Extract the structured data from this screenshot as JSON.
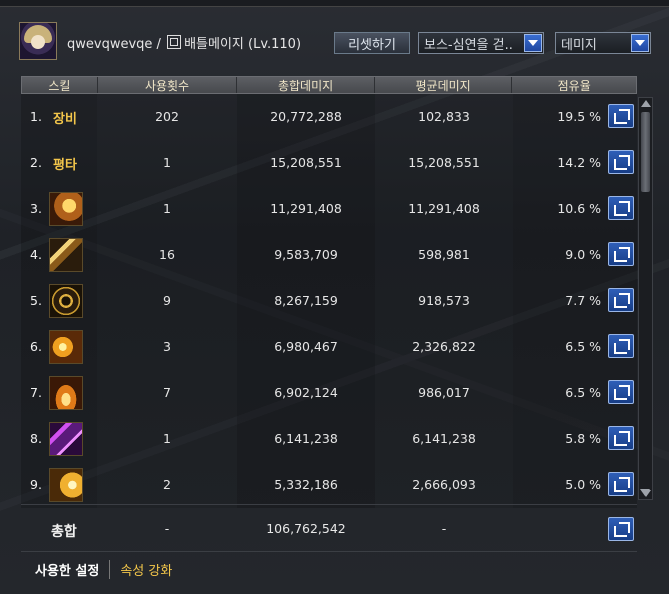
{
  "header": {
    "player_name": "qwevqwevqe",
    "separator": "/",
    "meter_title": "배틀메이지 (Lv.110)",
    "reset_button": "리셋하기",
    "dropdown_target": "보스-심연을 걷..",
    "dropdown_metric": "데미지"
  },
  "table": {
    "columns": [
      "스킬",
      "사용횟수",
      "총합데미지",
      "평균데미지",
      "점유율"
    ],
    "rows": [
      {
        "rank": "1.",
        "skill_text": "장비",
        "icon": null,
        "uses": "202",
        "total": "20,772,288",
        "avg": "102,833",
        "share": "19.5 %"
      },
      {
        "rank": "2.",
        "skill_text": "평타",
        "icon": null,
        "uses": "1",
        "total": "15,208,551",
        "avg": "15,208,551",
        "share": "14.2 %"
      },
      {
        "rank": "3.",
        "skill_text": "",
        "icon": "swirl-orb-skill-icon",
        "uses": "1",
        "total": "11,291,408",
        "avg": "11,291,408",
        "share": "10.6 %"
      },
      {
        "rank": "4.",
        "skill_text": "",
        "icon": "staff-strike-skill-icon",
        "uses": "16",
        "total": "9,583,709",
        "avg": "598,981",
        "share": "9.0 %"
      },
      {
        "rank": "5.",
        "skill_text": "",
        "icon": "star-circle-skill-icon",
        "uses": "9",
        "total": "8,267,159",
        "avg": "918,573",
        "share": "7.7 %"
      },
      {
        "rank": "6.",
        "skill_text": "",
        "icon": "meteor-burst-skill-icon",
        "uses": "3",
        "total": "6,980,467",
        "avg": "2,326,822",
        "share": "6.5 %"
      },
      {
        "rank": "7.",
        "skill_text": "",
        "icon": "flame-skill-icon",
        "uses": "7",
        "total": "6,902,124",
        "avg": "986,017",
        "share": "6.5 %"
      },
      {
        "rank": "8.",
        "skill_text": "",
        "icon": "purple-chain-skill-icon",
        "uses": "1",
        "total": "6,141,238",
        "avg": "6,141,238",
        "share": "5.8 %"
      },
      {
        "rank": "9.",
        "skill_text": "",
        "icon": "light-burst-skill-icon",
        "uses": "2",
        "total": "5,332,186",
        "avg": "2,666,093",
        "share": "5.0 %"
      }
    ]
  },
  "total": {
    "label": "총합",
    "uses": "-",
    "total": "106,762,542",
    "avg": "-"
  },
  "tabs": {
    "active": "사용한 설정",
    "other": "속성 강화"
  },
  "colors": {
    "gold_text": "#f3c64b",
    "button_blue": "#2f5fb8"
  }
}
